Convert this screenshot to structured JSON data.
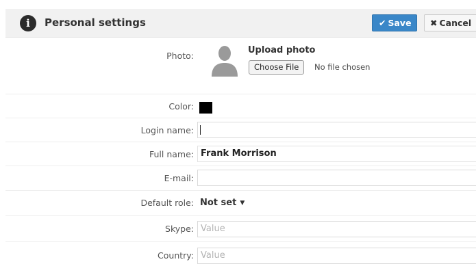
{
  "header": {
    "title": "Personal settings",
    "info_icon": "i",
    "save_icon": "✔",
    "save_label": "Save",
    "cancel_icon": "✖",
    "cancel_label": "Cancel"
  },
  "colors": {
    "accent": "#3a87c8",
    "header_bg": "#f1f1f1",
    "user_color": "#000000"
  },
  "form": {
    "photo": {
      "label": "Photo:",
      "upload_title": "Upload photo",
      "choose_file": "Choose File",
      "no_file": "No file chosen"
    },
    "color": {
      "label": "Color:"
    },
    "login_name": {
      "label": "Login name:",
      "value": ""
    },
    "full_name": {
      "label": "Full name:",
      "value": "Frank Morrison"
    },
    "email": {
      "label": "E-mail:",
      "value": ""
    },
    "default_role": {
      "label": "Default role:",
      "value": "Not set",
      "caret": "▼"
    },
    "skype": {
      "label": "Skype:",
      "placeholder": "Value"
    },
    "country": {
      "label": "Country:",
      "placeholder": "Value"
    }
  }
}
